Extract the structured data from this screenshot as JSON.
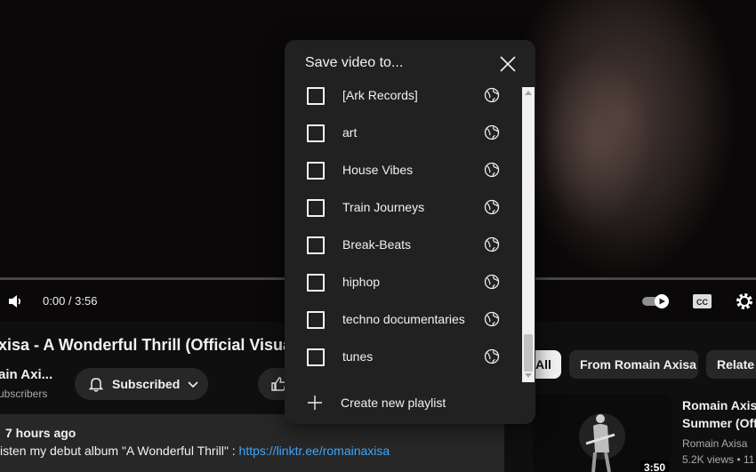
{
  "player": {
    "time": "0:00 / 3:56"
  },
  "video": {
    "title": "xisa - A Wonderful Thrill (Official Visua",
    "channel": "ain Axi...",
    "subscribers": "ubscribers",
    "subscribed_label": "Subscribed"
  },
  "description": {
    "meta": "7 hours ago",
    "text": "isten my debut album \"A Wonderful Thrill\" : ",
    "link": "https://linktr.ee/romainaxisa"
  },
  "chips": [
    {
      "label": "All",
      "active": true
    },
    {
      "label": "From Romain Axisa",
      "active": false
    },
    {
      "label": "Relate",
      "active": false
    }
  ],
  "recommendation": {
    "title_line1": "Romain Axisa",
    "title_line2": "Summer (Offi",
    "channel": "Romain Axisa",
    "views": "5.2K views • 11",
    "duration": "3:50"
  },
  "dialog": {
    "title": "Save video to...",
    "playlists": [
      {
        "label": "[Ark Records]",
        "checked": false,
        "visibility_icon": "globe-icon"
      },
      {
        "label": "art",
        "checked": false,
        "visibility_icon": "globe-icon"
      },
      {
        "label": "House Vibes",
        "checked": false,
        "visibility_icon": "globe-icon"
      },
      {
        "label": "Train Journeys",
        "checked": false,
        "visibility_icon": "globe-icon"
      },
      {
        "label": "Break-Beats",
        "checked": false,
        "visibility_icon": "globe-icon"
      },
      {
        "label": "hiphop",
        "checked": false,
        "visibility_icon": "globe-icon"
      },
      {
        "label": "techno documentaries",
        "checked": false,
        "visibility_icon": "globe-icon"
      },
      {
        "label": "tunes",
        "checked": false,
        "visibility_icon": "globe-icon"
      }
    ],
    "create_label": "Create new playlist"
  },
  "colors": {
    "page_bg": "#0f0f0f",
    "dialog_bg": "#212121",
    "link": "#3ea6ff",
    "chip_bg": "#272727"
  }
}
